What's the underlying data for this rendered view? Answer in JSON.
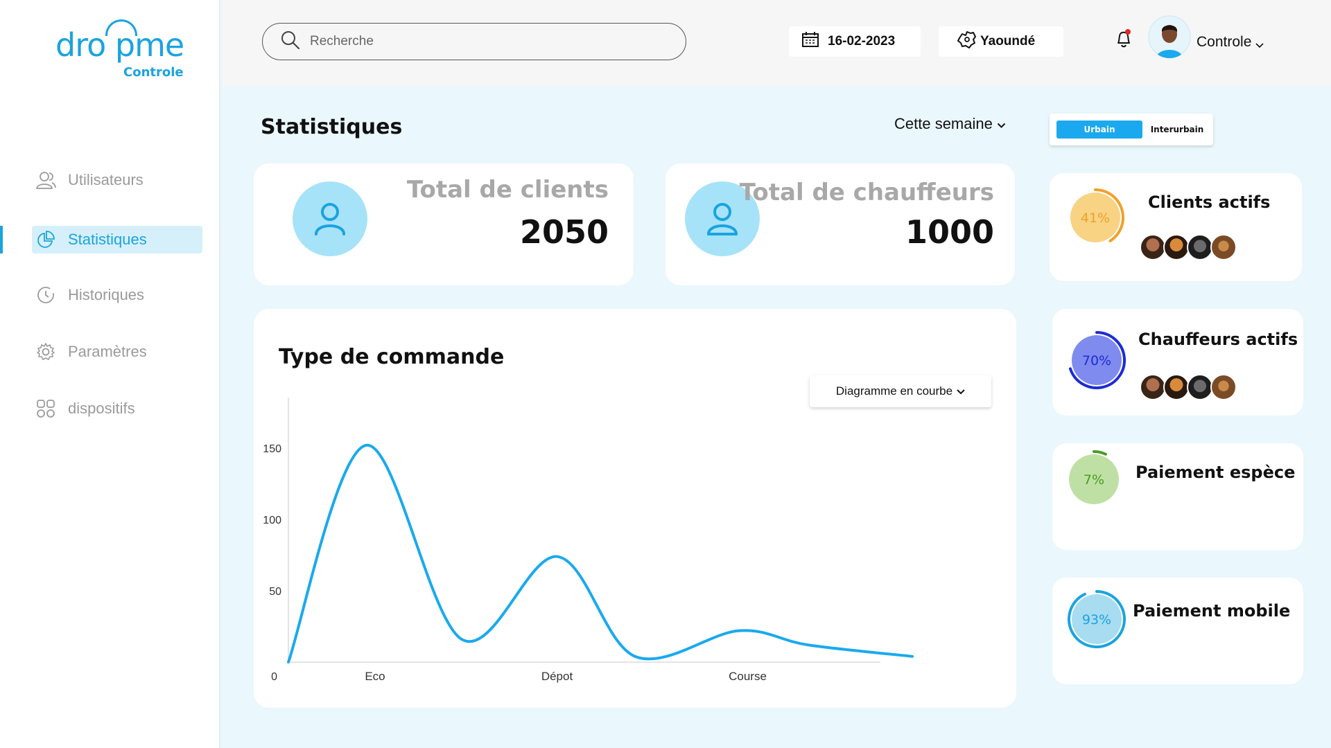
{
  "logo": {
    "main": "dro pme",
    "sub": "Controle"
  },
  "sidebar": {
    "items": [
      {
        "label": "Utilisateurs",
        "icon": "users-icon",
        "active": false
      },
      {
        "label": "Statistiques",
        "icon": "pie-chart-icon",
        "active": true
      },
      {
        "label": "Historiques",
        "icon": "history-icon",
        "active": false
      },
      {
        "label": "Paramètres",
        "icon": "gear-icon",
        "active": false
      },
      {
        "label": "dispositifs",
        "icon": "grid-icon",
        "active": false
      }
    ]
  },
  "header": {
    "search_placeholder": "Recherche",
    "date": "16-02-2023",
    "city": "Yaoundé",
    "user_name": "Controle"
  },
  "main": {
    "title": "Statistiques",
    "period": "Cette semaine",
    "toggle": {
      "active": "Urbain",
      "inactive": "Interurbain"
    },
    "stats": [
      {
        "label": "Total de clients",
        "value": "2050"
      },
      {
        "label": "Total de chauffeurs",
        "value": "1000"
      }
    ],
    "chart_title": "Type de commande",
    "chart_select": "Diagramme en courbe"
  },
  "side_cards": [
    {
      "title": "Clients actifs",
      "percent": "41%",
      "value": 41,
      "color": "#f0a12a",
      "fill": "#f8d384"
    },
    {
      "title": "Chauffeurs actifs",
      "percent": "70%",
      "value": 70,
      "color": "#1d2bd6",
      "fill": "#7f8bee"
    },
    {
      "title": "Paiement espèce",
      "percent": "7%",
      "value": 7,
      "color": "#4c9a22",
      "fill": "#bfe0a4"
    },
    {
      "title": "Paiement mobile",
      "percent": "93%",
      "value": 93,
      "color": "#1aa3e0",
      "fill": "#a8dcf0"
    }
  ],
  "chart_data": {
    "type": "line",
    "x": [
      0,
      0.45,
      1,
      1.55,
      2,
      2.6,
      3,
      3.6
    ],
    "y": [
      0,
      152,
      16,
      74,
      4,
      22,
      12,
      4
    ],
    "categories": [
      "Eco",
      "Dépot",
      "Course"
    ],
    "category_x": [
      0.5,
      1.55,
      2.65
    ],
    "y_ticks": [
      "0",
      "50",
      "100",
      "150"
    ],
    "ylim": [
      0,
      170
    ],
    "line_color": "#1aa9ee",
    "smooth": true
  }
}
